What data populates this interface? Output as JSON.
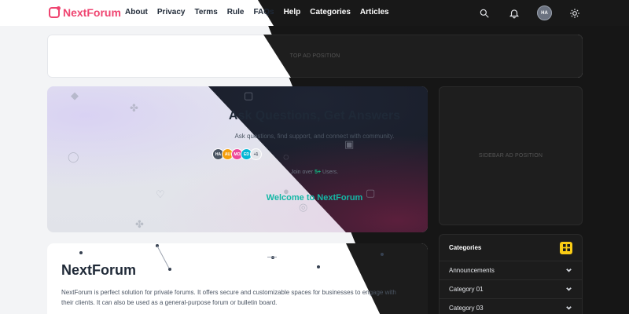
{
  "brand": {
    "name": "NextForum",
    "color": "#ef4470"
  },
  "nav": [
    "About",
    "Privacy",
    "Terms",
    "Rule",
    "FAQs",
    "Help",
    "Categories",
    "Articles"
  ],
  "header_icons": [
    "search-icon",
    "bell-icon",
    "sun-icon"
  ],
  "user_avatar": "HA",
  "top_ad_label": "TOP AD POSITION",
  "sidebar_ad_label": "SIDEBAR AD POSITION",
  "hero": {
    "title": "Ask Questions, Get Answers",
    "subtitle": "Ask questions, find support, and connect with community.",
    "avatars": [
      {
        "initials": "HA",
        "color": "#4b5563"
      },
      {
        "initials": "AU",
        "color": "#f59e0b"
      },
      {
        "initials": "MO",
        "color": "#ec4899"
      },
      {
        "initials": "ED",
        "color": "#06b6d4"
      },
      {
        "initials": "+1",
        "color": "#e5e7eb"
      }
    ],
    "join_prefix": "Join over",
    "join_count": "5+",
    "join_suffix": "Users.",
    "welcome": "Welcome to NextForum"
  },
  "content": {
    "title": "NextForum",
    "text": "NextForum is perfect solution for private forums. It offers secure and customizable spaces for businesses to engage with their clients. It can also be used as a general-purpose forum or bulletin board."
  },
  "categories": {
    "title": "Categories",
    "items": [
      "Announcements",
      "Category 01",
      "Category 03"
    ]
  },
  "colors": {
    "accent_teal": "#14b8a6",
    "accent_yellow": "#facc15",
    "join_green": "#10b981"
  }
}
